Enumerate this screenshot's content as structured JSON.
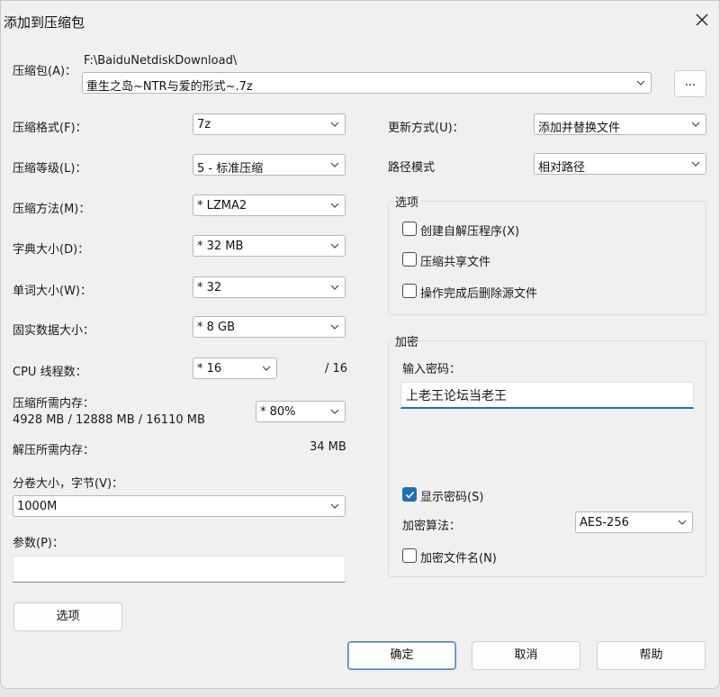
{
  "window": {
    "title": "添加到压缩包",
    "close_icon": "close-icon"
  },
  "archive": {
    "label": "压缩包(A)：",
    "path": "F:\\BaiduNetdiskDownload\\",
    "filename": "重生之岛~NTR与爱的形式~.7z",
    "browse_label": "..."
  },
  "left": {
    "format": {
      "label": "压缩格式(F)：",
      "value": "7z"
    },
    "level": {
      "label": "压缩等级(L)：",
      "value": "5 - 标准压缩"
    },
    "method": {
      "label": "压缩方法(M)：",
      "value": "*  LZMA2"
    },
    "dict": {
      "label": "字典大小(D)：",
      "value": "*  32 MB"
    },
    "word": {
      "label": "单词大小(W)：",
      "value": "*  32"
    },
    "solid": {
      "label": "固实数据大小：",
      "value": "*  8 GB"
    },
    "threads": {
      "label": "CPU 线程数：",
      "value": "*  16",
      "max": "/ 16"
    },
    "mem_compress": {
      "label": "压缩所需内存：",
      "detail": "4928 MB / 12888 MB / 16110 MB",
      "value": "*  80%"
    },
    "mem_decompress": {
      "label": "解压所需内存：",
      "value": "34 MB"
    },
    "volume": {
      "label": "分卷大小，字节(V)：",
      "value": "1000M"
    },
    "params": {
      "label": "参数(P)：",
      "value": ""
    },
    "options_button": "选项"
  },
  "right": {
    "update": {
      "label": "更新方式(U)：",
      "value": "添加并替换文件"
    },
    "path_mode": {
      "label": "路径模式",
      "value": "相对路径"
    },
    "options_group": {
      "title": "选项",
      "items": [
        {
          "label": "创建自解压程序(X)",
          "checked": false
        },
        {
          "label": "压缩共享文件",
          "checked": false
        },
        {
          "label": "操作完成后删除源文件",
          "checked": false
        }
      ]
    },
    "encrypt_group": {
      "title": "加密",
      "password_label": "输入密码：",
      "password_value": "上老王论坛当老王",
      "show_password": {
        "label": "显示密码(S)",
        "checked": true
      },
      "algorithm": {
        "label": "加密算法：",
        "value": "AES-256"
      },
      "encrypt_names": {
        "label": "加密文件名(N)",
        "checked": false
      }
    }
  },
  "buttons": {
    "ok": "确定",
    "cancel": "取消",
    "help": "帮助"
  },
  "colors": {
    "accent": "#1f6fb8",
    "window_bg": "#f0f0f0"
  }
}
